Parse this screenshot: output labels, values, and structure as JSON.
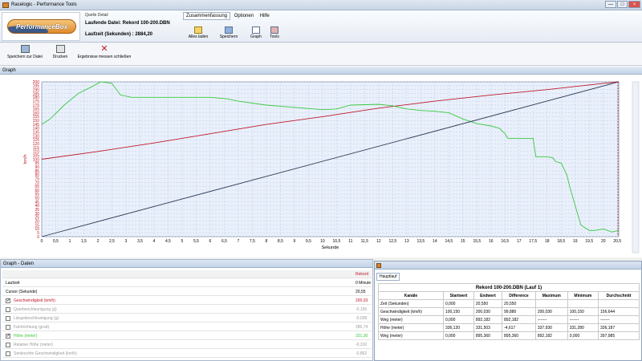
{
  "window": {
    "title": "Racelogic - Performance Tools",
    "min_label": "—",
    "max_label": "□",
    "close_label": "×"
  },
  "colors": {
    "speed": "#c0192a",
    "height": "#39c93d",
    "time": "#2b3a55",
    "plot_bg": "#e9f0fb",
    "grid": "#b9c9e3"
  },
  "ribbon": {
    "logo_text": "PerformanceBox",
    "quelle_label": "Quelle Detail",
    "current_file": "Laufende Datei: Rekord 100-200.DBN",
    "runtime": "Laufzeit (Sekunden) : 2884,20",
    "menu": [
      "Zusammenfassung",
      "Optionen",
      "Hilfe"
    ],
    "buttons": [
      {
        "label": "Alles laden",
        "icon": "folder-open-icon"
      },
      {
        "label": "Speichern",
        "icon": "save-icon"
      },
      {
        "label": "Graph",
        "icon": "chart-icon"
      },
      {
        "label": "Tools",
        "icon": "tools-icon"
      }
    ]
  },
  "toolbar": {
    "save_file": "Speichern zur Datei",
    "print": "Drucken",
    "close_results": "Ergebnisse messen schließen"
  },
  "graph": {
    "panel_title": "Graph"
  },
  "chart_data": {
    "type": "line",
    "xlabel": "Sekunde",
    "ylabel": "km/h",
    "xlim": [
      0,
      20.55
    ],
    "ylim": [
      0,
      200
    ],
    "xticks": [
      "0",
      "0,5",
      "1",
      "1,5",
      "2",
      "2,5",
      "3",
      "3,5",
      "4",
      "4,5",
      "5",
      "5,5",
      "6",
      "6,5",
      "7",
      "7,5",
      "8",
      "8,5",
      "9",
      "9,5",
      "10",
      "10,5",
      "11",
      "11,5",
      "12",
      "12,5",
      "13",
      "13,5",
      "14",
      "14,5",
      "15",
      "15,5",
      "16",
      "16,5",
      "17",
      "17,5",
      "18",
      "18,5",
      "19",
      "19,5",
      "20",
      "20,5"
    ],
    "yticks": [
      "0",
      "5",
      "10",
      "15",
      "20",
      "25",
      "30",
      "35",
      "40",
      "45",
      "50",
      "55",
      "60",
      "65",
      "70",
      "75",
      "80",
      "85",
      "90",
      "95",
      "100",
      "105",
      "110",
      "115",
      "120",
      "125",
      "130",
      "135",
      "140",
      "145",
      "150",
      "155",
      "160",
      "165",
      "170",
      "175",
      "180",
      "185",
      "190",
      "195",
      "200"
    ],
    "cursor_x": 20.55,
    "grid": true,
    "series": [
      {
        "name": "Geschwindigkeit (km/h)",
        "color": "#c0192a",
        "x": [
          0,
          2,
          4,
          6,
          8,
          10,
          12,
          14,
          16,
          18,
          20,
          20.55
        ],
        "y": [
          100,
          110,
          121,
          133,
          145,
          155,
          166,
          175,
          183,
          190,
          198,
          200
        ]
      },
      {
        "name": "Höhe (meter)",
        "color": "#39c93d",
        "x": [
          0,
          0.3,
          0.8,
          1.3,
          1.8,
          2.1,
          2.5,
          2.8,
          3.2,
          4,
          5,
          6,
          6.6,
          7,
          8,
          9,
          10,
          10.5,
          11,
          12,
          12.5,
          13,
          13.5,
          14,
          14.5,
          15,
          15.5,
          16,
          16.3,
          16.5,
          16.6,
          17,
          17.3,
          17.5,
          17.6,
          18,
          18.2,
          18.3,
          18.5,
          18.7,
          18.8,
          19,
          19.2,
          19.5,
          19.7,
          20,
          20.3,
          20.55
        ],
        "y": [
          145,
          152,
          170,
          185,
          194,
          200,
          198,
          183,
          180,
          180,
          180,
          180,
          178,
          175,
          170,
          167,
          164,
          165,
          170,
          171,
          169,
          165,
          163,
          162,
          160,
          152,
          146,
          143,
          140,
          133,
          127,
          127,
          127,
          127,
          103,
          103,
          102,
          97,
          95,
          80,
          65,
          40,
          15,
          8,
          8,
          10,
          6,
          8
        ]
      },
      {
        "name": "Zeit (Sekunden)",
        "color": "#2b3a55",
        "x": [
          0,
          20.55
        ],
        "y": [
          0,
          200
        ]
      }
    ]
  },
  "data_panel": {
    "title": "Graph - Daten",
    "header_value": "Rekord",
    "rows": [
      {
        "name": "Laufzeit",
        "value": "0 Minute",
        "checkable": false,
        "checked": false,
        "color": "#000000"
      },
      {
        "name": "Cursor (Sekunde)",
        "value": "20,55",
        "checkable": false,
        "checked": false,
        "color": "#000000"
      },
      {
        "name": "Geschwindigkeit (km/h)",
        "value": "200,03",
        "checkable": true,
        "checked": true,
        "color": "#c0192a"
      },
      {
        "name": "Querbeschleunigung (g)",
        "value": "-0,155",
        "checkable": true,
        "checked": false,
        "color": "#9a9a9a"
      },
      {
        "name": "Längsbeschleunigung (g)",
        "value": "-0,038",
        "checkable": true,
        "checked": false,
        "color": "#9a9a9a"
      },
      {
        "name": "Fahrtrichtung (grad)",
        "value": "285,74",
        "checkable": true,
        "checked": false,
        "color": "#9a9a9a"
      },
      {
        "name": "Höhe (meter)",
        "value": "331,30",
        "checkable": true,
        "checked": true,
        "color": "#39c93d"
      },
      {
        "name": "Relative Höhe (meter)",
        "value": "-0,310",
        "checkable": true,
        "checked": false,
        "color": "#9a9a9a"
      },
      {
        "name": "Senkrechte Geschwindigkeit (km/h)",
        "value": "-0,862",
        "checkable": true,
        "checked": false,
        "color": "#9a9a9a"
      }
    ]
  },
  "haupt_panel": {
    "tab": "Hauptlauf",
    "caption": "Rekord 100-200.DBN (Lauf 1)",
    "columns": [
      "Kanäle",
      "Startwert",
      "Endwert",
      "Difference",
      "Maximum",
      "Minimum",
      "Durchschnitt"
    ],
    "rows": [
      [
        "Zeit (Sekunden)",
        "0,000",
        "20,550",
        "20,550",
        "",
        "",
        ""
      ],
      [
        "Geschwindigkeit (km/h)",
        "100,150",
        "200,030",
        "99,880",
        "200,030",
        "100,150",
        "156,644"
      ],
      [
        "Weg (meter)",
        "0,000",
        "892,182",
        "892,182",
        "-------",
        "-------",
        "-------"
      ],
      [
        "Höhe (meter)",
        "336,120",
        "331,503",
        "-4,617",
        "337,930",
        "331,280",
        "336,187"
      ],
      [
        "Weg (meter)",
        "0,000",
        "895,360",
        "895,360",
        "892,182",
        "0,000",
        "397,985"
      ]
    ]
  }
}
